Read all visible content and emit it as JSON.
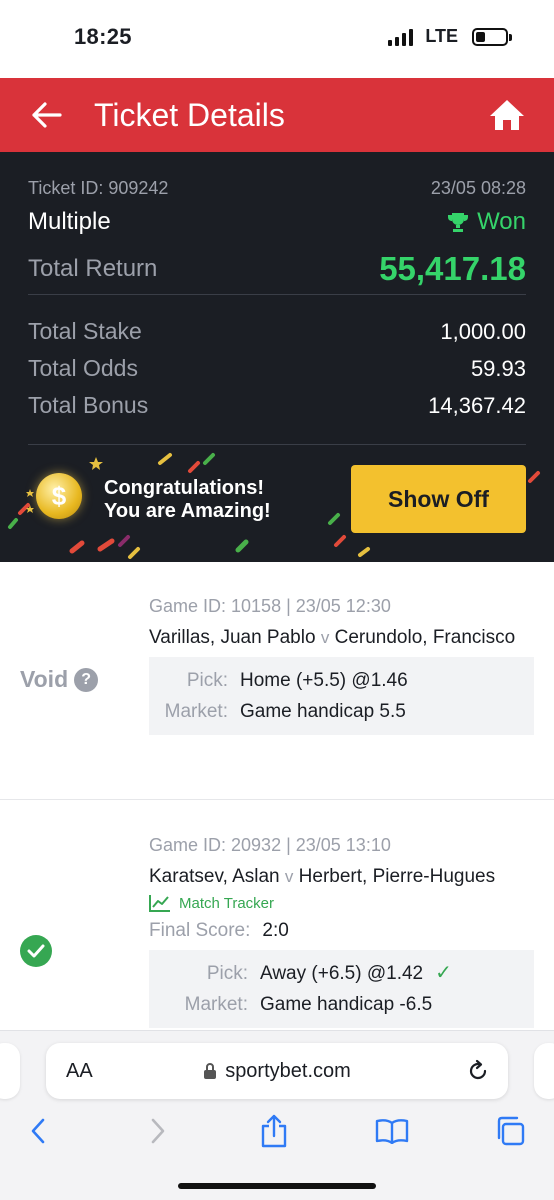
{
  "status_bar": {
    "time": "18:25",
    "network": "LTE"
  },
  "header": {
    "title": "Ticket Details"
  },
  "ticket": {
    "id_label": "Ticket ID: 909242",
    "datetime": "23/05 08:28",
    "type": "Multiple",
    "result": "Won",
    "total_return_label": "Total Return",
    "total_return": "55,417.18",
    "total_stake_label": "Total Stake",
    "total_stake": "1,000.00",
    "total_odds_label": "Total Odds",
    "total_odds": "59.93",
    "total_bonus_label": "Total Bonus",
    "total_bonus": "14,367.42"
  },
  "promo": {
    "line1": "Congratulations!",
    "line2": "You are Amazing!",
    "button_label": "Show Off",
    "coin_symbol": "$"
  },
  "bets": [
    {
      "status": "Void",
      "help": "?",
      "game_line": "Game ID: 10158 | 23/05 12:30",
      "home": "Varillas, Juan Pablo",
      "vs": "v",
      "away": "Cerundolo, Francisco",
      "pick_label": "Pick:",
      "pick": "Home (+5.5) @1.46",
      "market_label": "Market:",
      "market": "Game handicap 5.5"
    },
    {
      "status": "won",
      "game_line": "Game ID: 20932 | 23/05 13:10",
      "home": "Karatsev, Aslan",
      "vs": "v",
      "away": "Herbert, Pierre-Hugues",
      "tracker": "Match Tracker",
      "final_label": "Final Score:",
      "final_score": "2:0",
      "pick_label": "Pick:",
      "pick": "Away (+6.5) @1.42",
      "market_label": "Market:",
      "market": "Game handicap -6.5"
    }
  ],
  "browser": {
    "aa": "AA",
    "url": "sportybet.com"
  },
  "colors": {
    "brand_red": "#d9333a",
    "won_green": "#35d46a",
    "check_green": "#36a752",
    "button_yellow": "#f3c12e",
    "dark_bg": "#1b1e24"
  }
}
